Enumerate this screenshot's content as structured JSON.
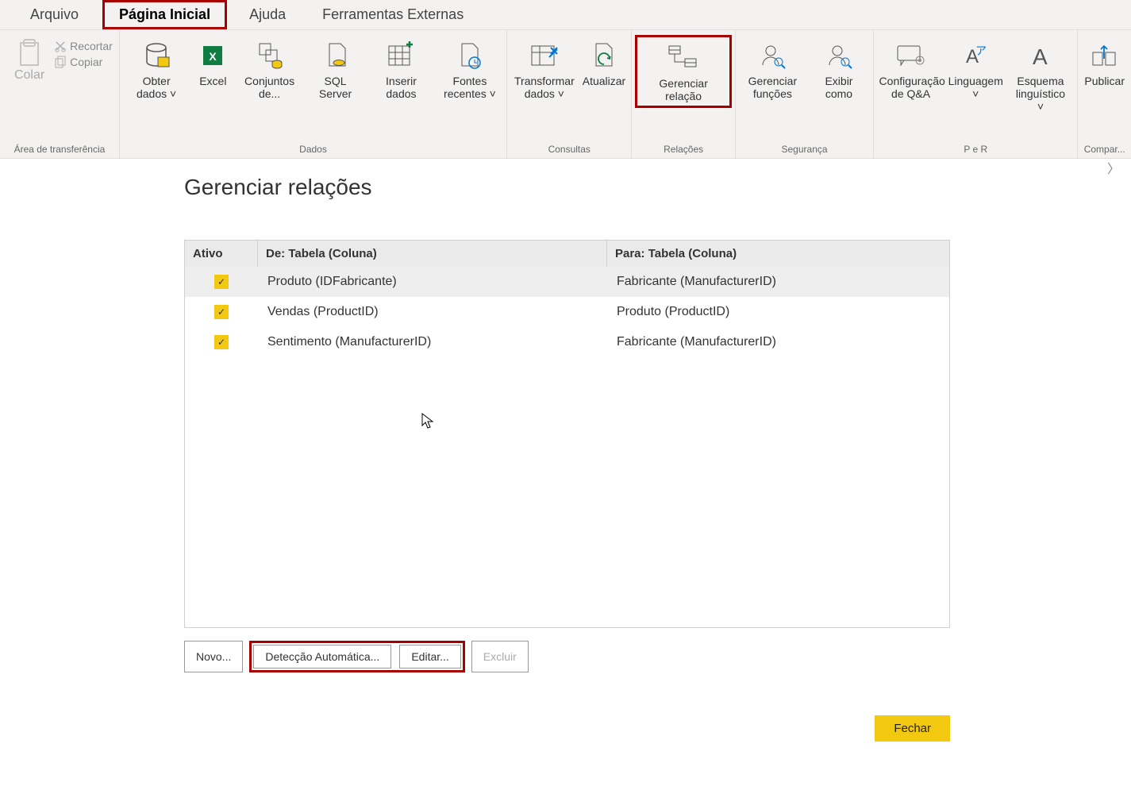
{
  "tabs": {
    "arquivo": "Arquivo",
    "pagina_inicial": "Página Inicial",
    "ajuda": "Ajuda",
    "ferramentas": "Ferramentas Externas"
  },
  "ribbon": {
    "groups": {
      "clipboard": {
        "label": "Área de transferência",
        "colar": "Colar",
        "recortar": "Recortar",
        "copiar": "Copiar"
      },
      "dados": {
        "label": "Dados",
        "obter": "Obter dados",
        "excel": "Excel",
        "conjuntos": "Conjuntos de...",
        "sql": "SQL Server",
        "inserir": "Inserir dados",
        "fontes": "Fontes recentes"
      },
      "consultas": {
        "label": "Consultas",
        "transformar": "Transformar dados",
        "atualizar": "Atualizar"
      },
      "relacoes": {
        "label": "Relações",
        "gerenciar": "Gerenciar relação"
      },
      "seguranca": {
        "label": "Segurança",
        "gerenciar_func": "Gerenciar funções",
        "exibir_como": "Exibir como"
      },
      "per": {
        "label": "P e R",
        "config_qa": "Configuração de Q&A",
        "linguagem": "Linguagem",
        "esquema": "Esquema linguístico"
      },
      "compartilhar": {
        "label": "Compar...",
        "publicar": "Publicar"
      }
    }
  },
  "dialog": {
    "title": "Gerenciar relações",
    "headers": {
      "ativo": "Ativo",
      "de": "De: Tabela (Coluna)",
      "para": "Para: Tabela (Coluna)"
    },
    "rows": [
      {
        "active": true,
        "from": "Produto (IDFabricante)",
        "to": "Fabricante (ManufacturerID)",
        "selected": true
      },
      {
        "active": true,
        "from": "Vendas (ProductID)",
        "to": "Produto (ProductID)",
        "selected": false
      },
      {
        "active": true,
        "from": "Sentimento (ManufacturerID)",
        "to": "Fabricante (ManufacturerID)",
        "selected": false
      }
    ],
    "buttons": {
      "novo": "Novo...",
      "autodeteccao": "Detecção Automática...",
      "editar": "Editar...",
      "excluir": "Excluir",
      "fechar": "Fechar"
    }
  }
}
